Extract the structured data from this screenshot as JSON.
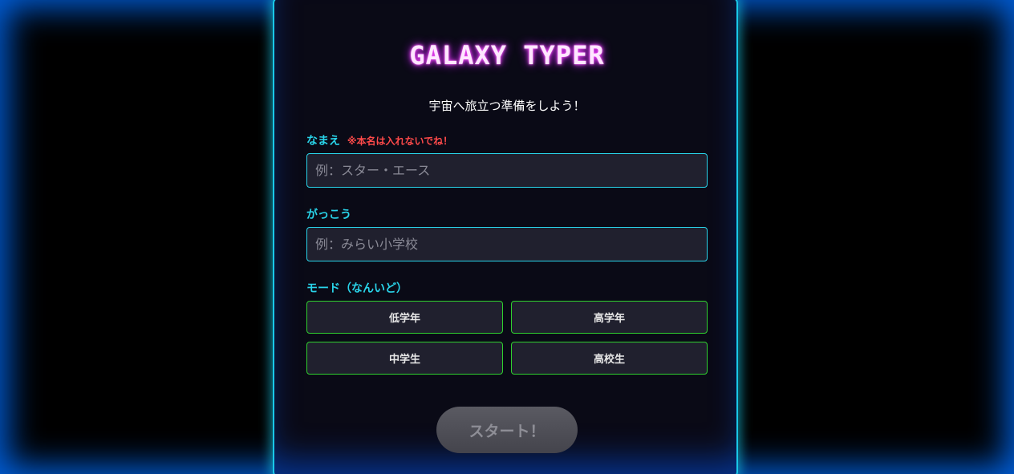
{
  "app": {
    "title": "GALAXY TYPER",
    "subtitle": "宇宙へ旅立つ準備をしよう！"
  },
  "form": {
    "name": {
      "label": "なまえ",
      "warning": "※本名は入れないでね！",
      "placeholder": "例：スター・エース",
      "value": ""
    },
    "school": {
      "label": "がっこう",
      "placeholder": "例：みらい小学校",
      "value": ""
    },
    "mode": {
      "label": "モード（なんいど）",
      "options": [
        "低学年",
        "高学年",
        "中学生",
        "高校生"
      ]
    },
    "start_label": "スタート！"
  },
  "colors": {
    "accent": "#29d4ea",
    "title_glow": "#ff4dff",
    "mode_border": "#2fd12f",
    "warning": "#ff4a4a"
  }
}
